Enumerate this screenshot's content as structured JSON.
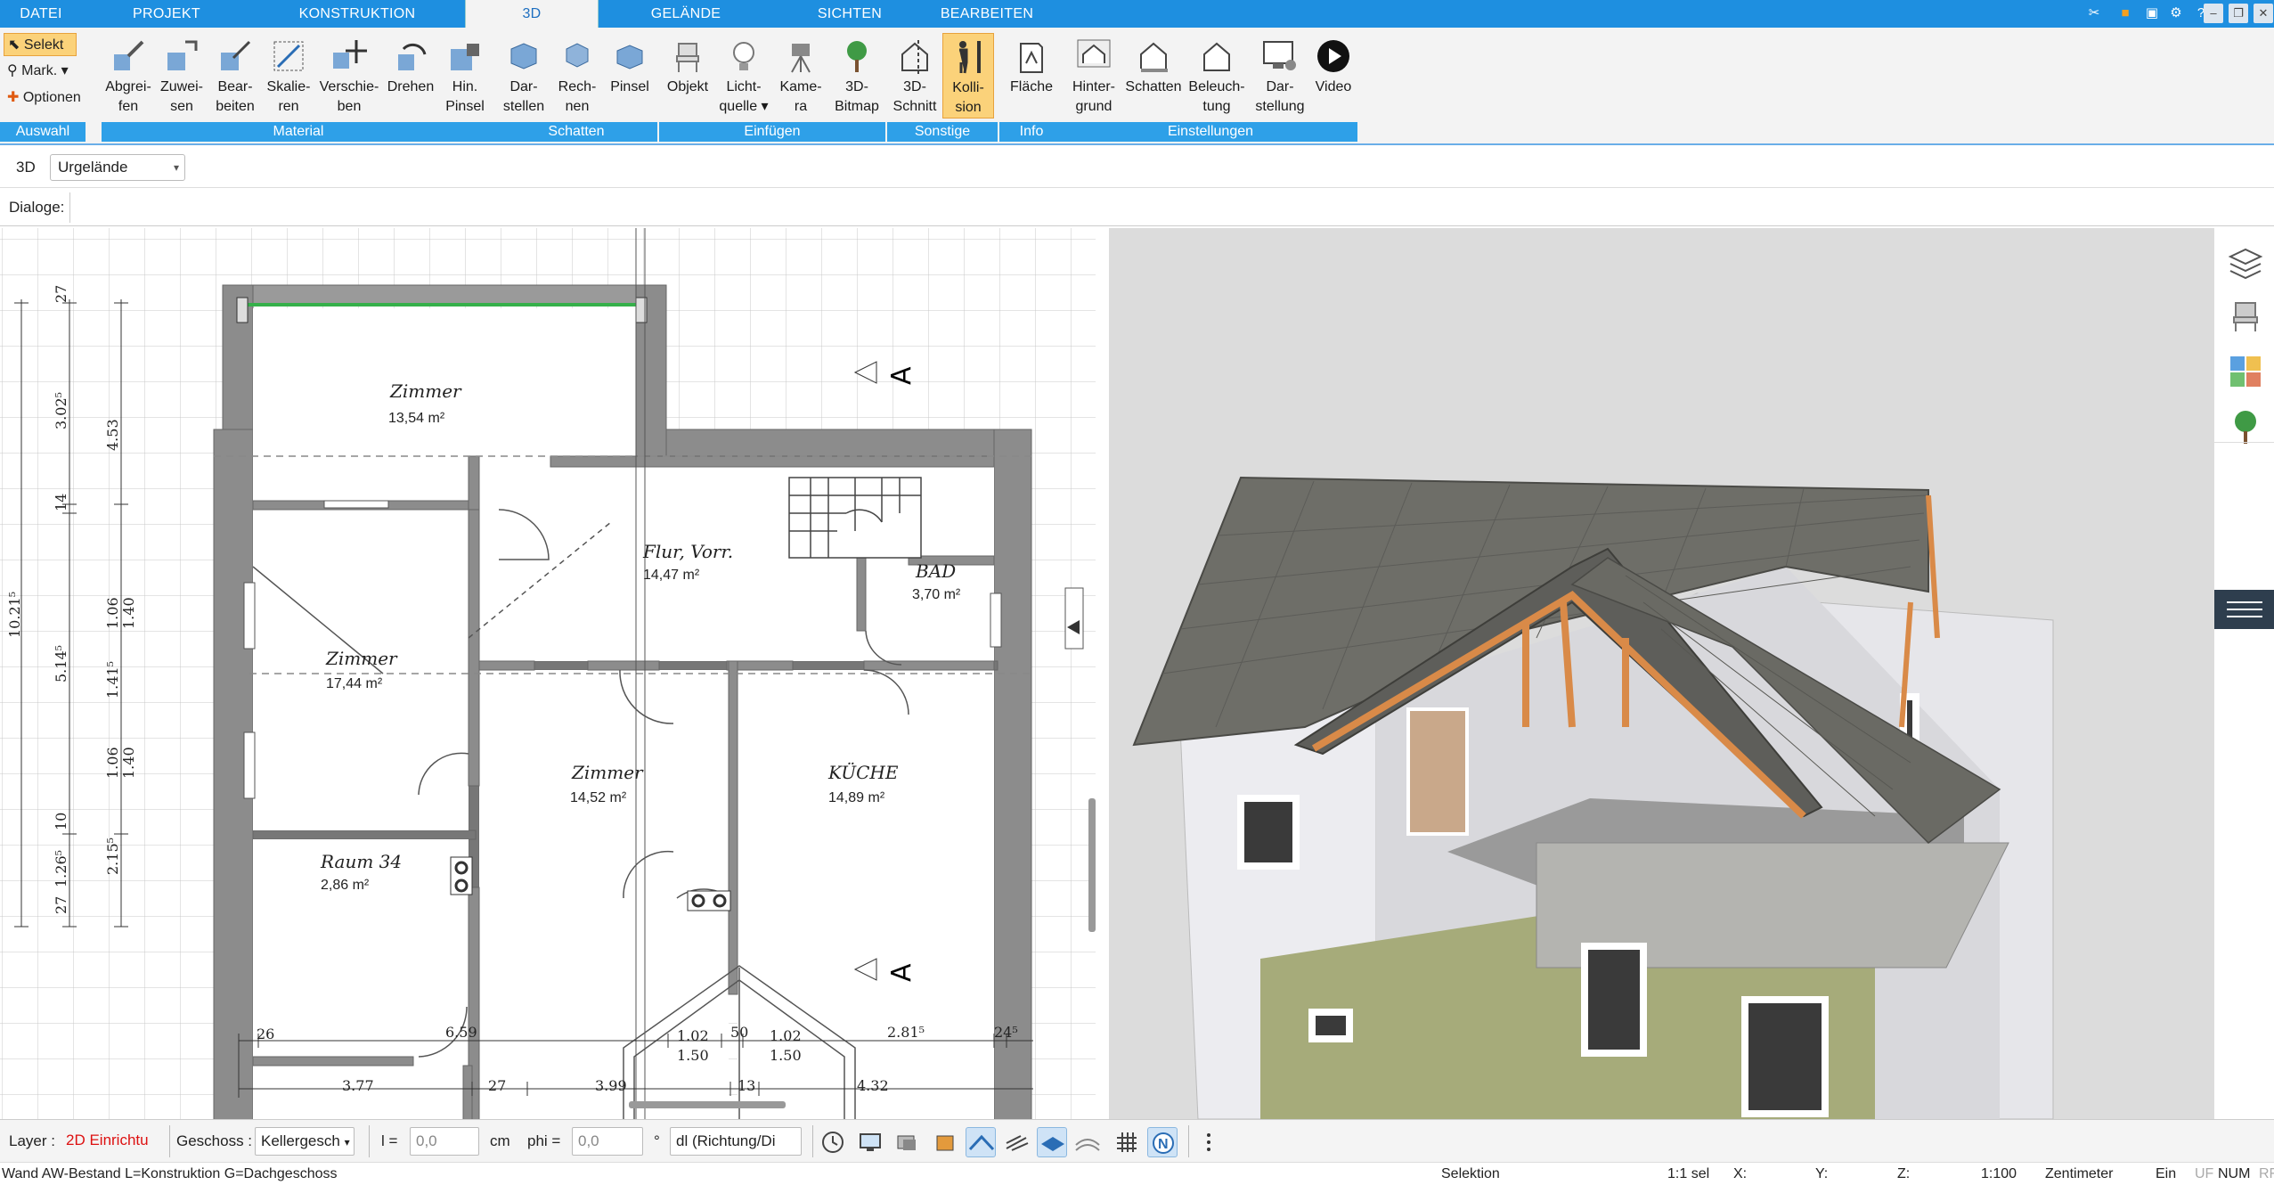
{
  "tabs": [
    {
      "label": "DATEI"
    },
    {
      "label": "PROJEKT"
    },
    {
      "label": "KONSTRUKTION"
    },
    {
      "label": "3D"
    },
    {
      "label": "GELÄNDE"
    },
    {
      "label": "SICHTEN"
    },
    {
      "label": "BEARBEITEN"
    }
  ],
  "ribbon": {
    "selekt": "Selekt",
    "mark": "Mark.",
    "optionen": "Optionen",
    "groups": {
      "auswahl": "Auswahl",
      "material": "Material",
      "schatten": "Schatten",
      "einfuegen": "Einfügen",
      "sonstige": "Sonstige",
      "info": "Info",
      "einstellungen": "Einstellungen"
    },
    "buttons": [
      {
        "l1": "Abgrei-",
        "l2": "fen"
      },
      {
        "l1": "Zuwei-",
        "l2": "sen"
      },
      {
        "l1": "Bear-",
        "l2": "beiten"
      },
      {
        "l1": "Skalie-",
        "l2": "ren"
      },
      {
        "l1": "Verschie-",
        "l2": "ben"
      },
      {
        "l1": "Drehen",
        "l2": ""
      },
      {
        "l1": "Hin.",
        "l2": "Pinsel"
      },
      {
        "l1": "Dar-",
        "l2": "stellen"
      },
      {
        "l1": "Rech-",
        "l2": "nen"
      },
      {
        "l1": "Pinsel",
        "l2": ""
      },
      {
        "l1": "Objekt",
        "l2": ""
      },
      {
        "l1": "Licht-",
        "l2": "quelle"
      },
      {
        "l1": "Kame-",
        "l2": "ra"
      },
      {
        "l1": "3D-",
        "l2": "Bitmap"
      },
      {
        "l1": "3D-",
        "l2": "Schnitt"
      },
      {
        "l1": "Kolli-",
        "l2": "sion"
      },
      {
        "l1": "Fläche",
        "l2": ""
      },
      {
        "l1": "Hinter-",
        "l2": "grund"
      },
      {
        "l1": "Schatten",
        "l2": ""
      },
      {
        "l1": "Beleuch-",
        "l2": "tung"
      },
      {
        "l1": "Dar-",
        "l2": "stellung"
      },
      {
        "l1": "Video",
        "l2": ""
      }
    ]
  },
  "row3d": {
    "label": "3D",
    "combo": "Urgelände"
  },
  "dialoge": "Dialoge:",
  "plan": {
    "rooms": [
      {
        "name": "Zimmer",
        "area": "13,54 m²"
      },
      {
        "name": "Flur, Vorr.",
        "area": "14,47 m²"
      },
      {
        "name": "BAD",
        "area": "3,70 m²"
      },
      {
        "name": "Zimmer",
        "area": "17,44 m²"
      },
      {
        "name": "Zimmer",
        "area": "14,52 m²"
      },
      {
        "name": "KÜCHE",
        "area": "14,89 m²"
      },
      {
        "name": "Raum 34",
        "area": "2,86 m²"
      }
    ],
    "section_label": "A",
    "dims_bottom": [
      "26",
      "6.59",
      "1.02",
      "50",
      "1.02",
      "2.81⁵",
      "24⁵",
      "1.50",
      "1.50",
      "3.77",
      "27",
      "3.99",
      "13",
      "4.32"
    ],
    "dims_left": [
      "10.21⁵",
      "3.02⁵",
      "14",
      "5.14⁵",
      "10",
      "1.26⁵",
      "27",
      "4.53",
      "1.06",
      "1.41⁵",
      "1.06",
      "2.15⁵",
      "1.40",
      "1.40",
      "27"
    ]
  },
  "bottombar": {
    "layer_label": "Layer :",
    "layer_value": "2D Einrichtu",
    "geschoss_label": "Geschoss :",
    "geschoss_value": "Kellergesch",
    "l_label": "l =",
    "l_value": "0,0",
    "l_unit": "cm",
    "phi_label": "phi =",
    "phi_value": "0,0",
    "phi_unit": "°",
    "dl_value": "dl (Richtung/Di"
  },
  "status": {
    "left": "Wand AW-Bestand L=Konstruktion G=Dachgeschoss",
    "selektion": "Selektion",
    "sel": "1:1 sel",
    "x": "X:",
    "y": "Y:",
    "z": "Z:",
    "scale": "1:100",
    "unit": "Zentimeter",
    "ein": "Ein",
    "uf": "UF",
    "num": "NUM",
    "rf": "RF"
  },
  "colors": {
    "accent": "#1e8fe0",
    "group_label": "#2ea0e8",
    "highlight": "#fbd27a",
    "wall": "#8a8a8a",
    "roof": "#6b6b66",
    "timber": "#d9894a"
  }
}
